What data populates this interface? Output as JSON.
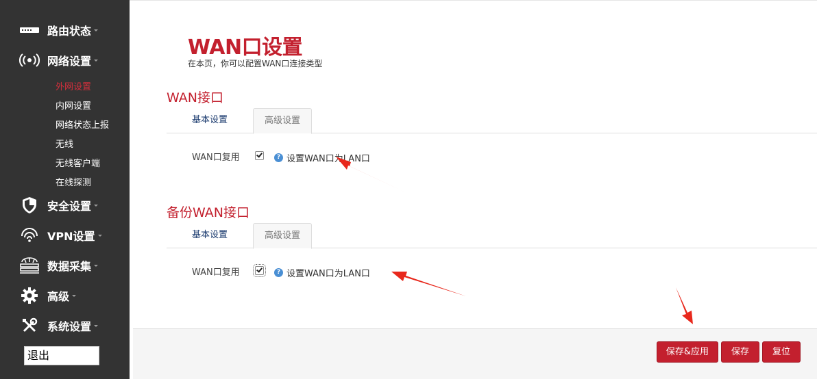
{
  "sidebar": {
    "menu": [
      {
        "label": "路由状态",
        "icon": "router-icon"
      },
      {
        "label": "网络设置",
        "icon": "wireless-signal-icon"
      },
      {
        "label": "安全设置",
        "icon": "shield-icon"
      },
      {
        "label": "VPN设置",
        "icon": "vpn-icon"
      },
      {
        "label": "数据采集",
        "icon": "data-collection-icon"
      },
      {
        "label": "高级",
        "icon": "gear-icon"
      },
      {
        "label": "系统设置",
        "icon": "tools-icon"
      }
    ],
    "submenu": [
      "外网设置",
      "内网设置",
      "网络状态上报",
      "无线",
      "无线客户端",
      "在线探测"
    ],
    "active_submenu": "外网设置",
    "logout": "退出"
  },
  "page": {
    "title": "WAN口设置",
    "description": "在本页，你可以配置WAN口连接类型"
  },
  "sections": [
    {
      "title": "WAN接口",
      "tabs": [
        "基本设置",
        "高级设置"
      ],
      "active_tab": "高级设置",
      "field_label": "WAN口复用",
      "checked": true,
      "help_text": "设置WAN口为LAN口"
    },
    {
      "title": "备份WAN接口",
      "tabs": [
        "基本设置",
        "高级设置"
      ],
      "active_tab": "高级设置",
      "field_label": "WAN口复用",
      "checked": true,
      "help_text": "设置WAN口为LAN口"
    }
  ],
  "footer": {
    "save_apply": "保存&应用",
    "save": "保存",
    "reset": "复位"
  },
  "colors": {
    "sidebar_bg": "#333333",
    "accent": "#c3202e",
    "annotation_arrow": "#e8281c"
  }
}
